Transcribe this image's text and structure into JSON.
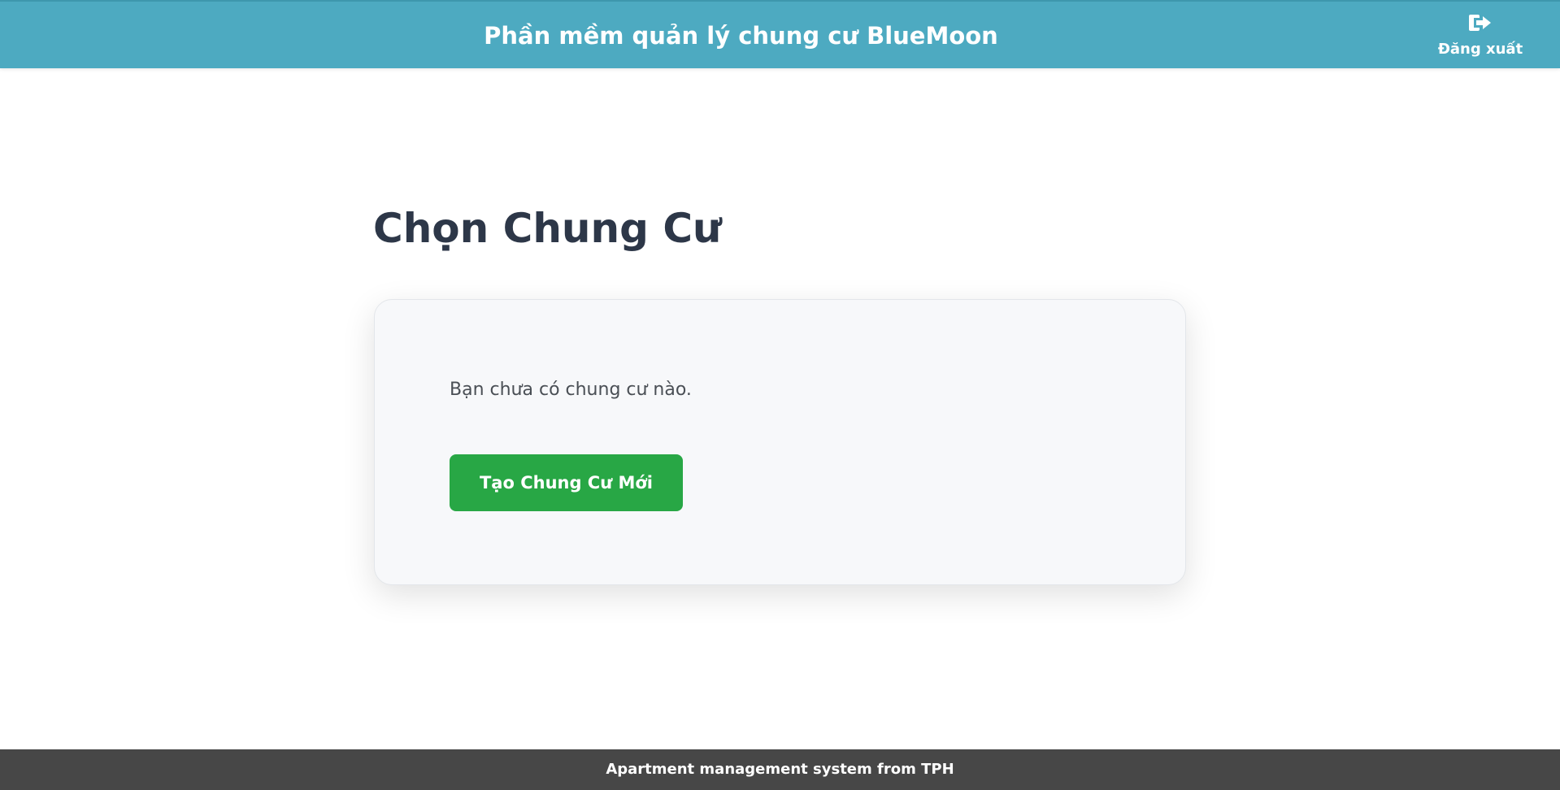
{
  "header": {
    "title": "Phần mềm quản lý chung cư BlueMoon",
    "background_color": "#4daac1",
    "logout": {
      "icon": "sign-out-icon",
      "label": "Đăng xuất"
    }
  },
  "main": {
    "heading": "Chọn Chung Cư",
    "card": {
      "empty_message": "Bạn chưa có chung cư nào.",
      "create_button_label": "Tạo Chung Cư Mới",
      "create_button_color": "#28a745"
    }
  },
  "footer": {
    "text": "Apartment management system from TPH",
    "background_color": "#474747"
  }
}
